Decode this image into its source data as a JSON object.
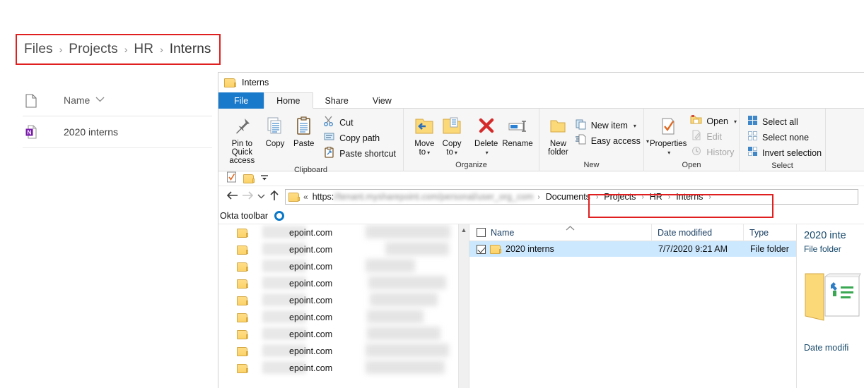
{
  "sharepoint": {
    "breadcrumb": [
      "Files",
      "Projects",
      "HR",
      "Interns"
    ],
    "separator": "›",
    "list_header": {
      "name_label": "Name",
      "sort_icon": "chevron-down-icon"
    },
    "files": [
      {
        "name": "2020 interns",
        "icon": "onenote-icon"
      }
    ]
  },
  "explorer": {
    "title": "Interns",
    "title_icon": "folder-icon",
    "tabs": [
      {
        "label": "File",
        "kind": "file"
      },
      {
        "label": "Home",
        "kind": "active"
      },
      {
        "label": "Share",
        "kind": "normal"
      },
      {
        "label": "View",
        "kind": "normal"
      }
    ],
    "ribbon": {
      "groups": [
        {
          "label": "Clipboard",
          "big": [
            {
              "label": "Pin to Quick access",
              "icon": "pin-icon"
            },
            {
              "label": "Copy",
              "icon": "copy-icon"
            },
            {
              "label": "Paste",
              "icon": "paste-icon"
            }
          ],
          "small": [
            {
              "label": "Cut",
              "icon": "scissors-icon",
              "disabled": false,
              "caret": false
            },
            {
              "label": "Copy path",
              "icon": "copy-path-icon",
              "disabled": false,
              "caret": false
            },
            {
              "label": "Paste shortcut",
              "icon": "paste-shortcut-icon",
              "disabled": false,
              "caret": false
            }
          ]
        },
        {
          "label": "Organize",
          "big": [
            {
              "label": "Move to",
              "icon": "move-to-icon",
              "caret": true
            },
            {
              "label": "Copy to",
              "icon": "copy-to-icon",
              "caret": true
            },
            {
              "label": "Delete",
              "icon": "delete-icon",
              "caret": true
            },
            {
              "label": "Rename",
              "icon": "rename-icon"
            }
          ],
          "small": []
        },
        {
          "label": "New",
          "big": [
            {
              "label": "New folder",
              "icon": "new-folder-icon"
            }
          ],
          "small": [
            {
              "label": "New item",
              "icon": "new-item-icon",
              "disabled": false,
              "caret": true
            },
            {
              "label": "Easy access",
              "icon": "easy-access-icon",
              "disabled": false,
              "caret": true
            }
          ]
        },
        {
          "label": "Open",
          "big": [
            {
              "label": "Properties",
              "icon": "properties-icon",
              "caret": true
            }
          ],
          "small": [
            {
              "label": "Open",
              "icon": "open-icon",
              "disabled": false,
              "caret": true
            },
            {
              "label": "Edit",
              "icon": "edit-icon",
              "disabled": true,
              "caret": false
            },
            {
              "label": "History",
              "icon": "history-icon",
              "disabled": true,
              "caret": false
            }
          ]
        },
        {
          "label": "Select",
          "big": [],
          "small": [
            {
              "label": "Select all",
              "icon": "select-all-icon",
              "disabled": false,
              "caret": false
            },
            {
              "label": "Select none",
              "icon": "select-none-icon",
              "disabled": false,
              "caret": false
            },
            {
              "label": "Invert selection",
              "icon": "invert-selection-icon",
              "disabled": false,
              "caret": false
            }
          ]
        }
      ]
    },
    "quick_access_toolbar": {
      "items": [
        {
          "icon": "properties-icon"
        },
        {
          "icon": "new-folder-icon"
        },
        {
          "icon": "customize-dropdown-icon"
        }
      ]
    },
    "address_bar": {
      "back_icon": "arrow-left-icon",
      "forward_icon": "arrow-right-icon",
      "recent_icon": "chevron-down-icon",
      "up_icon": "arrow-up-icon",
      "location_icon": "folder-icon",
      "overflow": "«",
      "url_prefix": "https:",
      "url_blurred": "//tenant.mysharepoint.com/personal/user_org_com",
      "crumbs": [
        "Documents",
        "Projects",
        "HR",
        "Interns"
      ],
      "crumb_separator": "›",
      "trailing_separator": "›"
    },
    "okta_bar": {
      "label": "Okta toolbar",
      "icon": "okta-circle-icon",
      "color": "#0a78c8"
    },
    "nav_pane": {
      "items": [
        {
          "text": "epoint.com",
          "icon": "folder-icon"
        },
        {
          "text": "epoint.com",
          "icon": "folder-icon"
        },
        {
          "text": "epoint.com",
          "icon": "folder-icon"
        },
        {
          "text": "epoint.com",
          "icon": "folder-icon"
        },
        {
          "text": "epoint.com",
          "icon": "folder-icon"
        },
        {
          "text": "epoint.com",
          "icon": "folder-icon"
        },
        {
          "text": "epoint.com",
          "icon": "folder-icon"
        },
        {
          "text": "epoint.com",
          "icon": "folder-icon"
        },
        {
          "text": "epoint.com",
          "icon": "folder-icon"
        }
      ],
      "scroll_up_icon": "chevron-up-icon"
    },
    "file_list": {
      "columns": [
        "Name",
        "Date modified",
        "Type"
      ],
      "sort_icon": "sort-ascending-icon",
      "rows": [
        {
          "name": "2020 interns",
          "date_modified": "7/7/2020 9:21 AM",
          "type": "File folder",
          "icon": "folder-icon",
          "selected": true,
          "checked": true
        }
      ]
    },
    "details_pane": {
      "title": "2020 inte",
      "subtitle": "File folder",
      "preview_icon": "open-folder-icon",
      "date_label": "Date modifi"
    }
  },
  "annotations": {
    "highlight_color": "#e02020"
  }
}
